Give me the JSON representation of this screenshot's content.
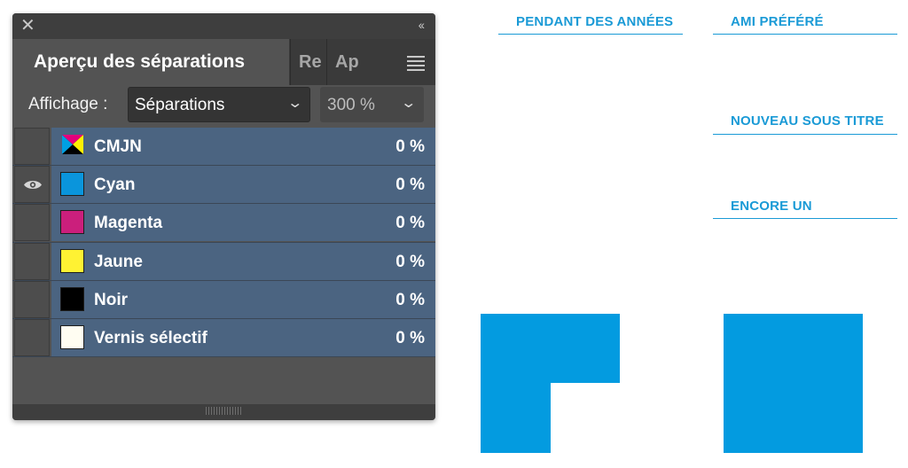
{
  "document": {
    "headings": [
      {
        "text": "PENDANT DES ANNÉES"
      },
      {
        "text": "AMI PRÉFÉRÉ"
      },
      {
        "text": "NOUVEAU SOUS TITRE"
      },
      {
        "text": "ENCORE UN"
      }
    ],
    "accent_color": "#039be0"
  },
  "panel": {
    "close_icon": "close-icon",
    "collapse_icon": "double-chevron-left-icon",
    "active_tab": "Aperçu des séparations",
    "tabs": [
      "Re",
      "Ap"
    ],
    "menu_icon": "hamburger-menu-icon",
    "view_label": "Affichage :",
    "view_value": "Séparations",
    "zoom_value": "300 %",
    "rows": [
      {
        "name": "CMJN",
        "percent": "0 %",
        "visible": false,
        "swatch": "cmyk"
      },
      {
        "name": "Cyan",
        "percent": "0 %",
        "visible": true,
        "swatch": "#0a95dc"
      },
      {
        "name": "Magenta",
        "percent": "0 %",
        "visible": false,
        "swatch": "#cb1f7c"
      },
      {
        "name": "Jaune",
        "percent": "0 %",
        "visible": false,
        "swatch": "#fff233"
      },
      {
        "name": "Noir",
        "percent": "0 %",
        "visible": false,
        "swatch": "#000000"
      },
      {
        "name": "Vernis sélectif",
        "percent": "0 %",
        "visible": false,
        "swatch": "#fffdf2"
      }
    ]
  }
}
